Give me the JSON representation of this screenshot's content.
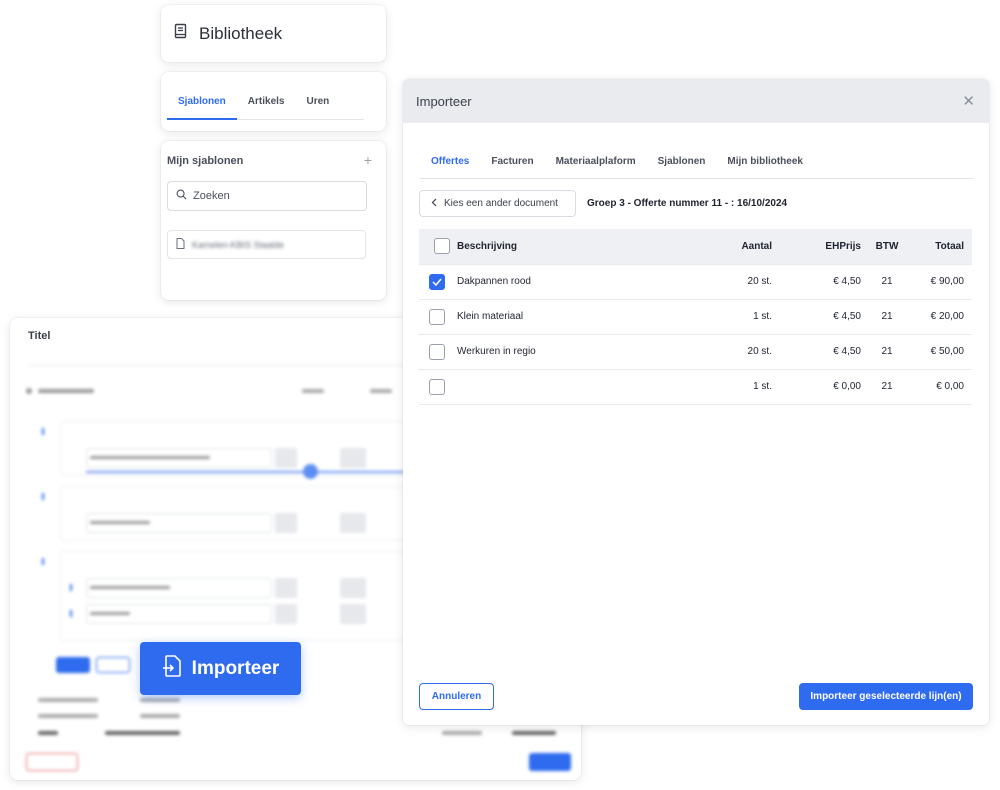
{
  "library": {
    "title": "Bibliotheek",
    "icon": "book-icon",
    "tabs": [
      {
        "label": "Sjablonen",
        "active": true
      },
      {
        "label": "Artikels",
        "active": false
      },
      {
        "label": "Uren",
        "active": false
      }
    ],
    "templates": {
      "heading": "Mijn sjablonen",
      "search_placeholder": "Zoeken",
      "items": [
        {
          "label": "Kamelen-KBIS Staalde"
        }
      ]
    }
  },
  "form": {
    "title_label": "Titel",
    "import_button_label": "Importeer"
  },
  "modal": {
    "title": "Importeer",
    "tabs": [
      {
        "label": "Offertes",
        "active": true
      },
      {
        "label": "Facturen",
        "active": false
      },
      {
        "label": "Materiaalplaform",
        "active": false
      },
      {
        "label": "Sjablonen",
        "active": false
      },
      {
        "label": "Mijn bibliotheek",
        "active": false
      }
    ],
    "back_button": "Kies een ander document",
    "document_title": "Groep 3 - Offerte nummer 11 - : 16/10/2024",
    "table": {
      "headers": {
        "description": "Beschrijving",
        "quantity": "Aantal",
        "unit_price": "EHPrijs",
        "vat": "BTW",
        "total": "Totaal"
      },
      "rows": [
        {
          "checked": true,
          "description": "Dakpannen rood",
          "quantity": "20 st.",
          "unit_price": "€ 4,50",
          "vat": "21",
          "total": "€ 90,00"
        },
        {
          "checked": false,
          "description": "Klein materiaal",
          "quantity": "1 st.",
          "unit_price": "€ 4,50",
          "vat": "21",
          "total": "€ 20,00"
        },
        {
          "checked": false,
          "description": "Werkuren in regio",
          "quantity": "20 st.",
          "unit_price": "€ 4,50",
          "vat": "21",
          "total": "€ 50,00"
        },
        {
          "checked": false,
          "description": "",
          "quantity": "1 st.",
          "unit_price": "€ 0,00",
          "vat": "21",
          "total": "€ 0,00"
        }
      ]
    },
    "cancel_button": "Annuleren",
    "import_button": "Importeer geselecteerde lijn(en)"
  },
  "colors": {
    "accent": "#2f6bef",
    "modal_header": "#e9ebef",
    "table_header": "#eef0f3"
  }
}
